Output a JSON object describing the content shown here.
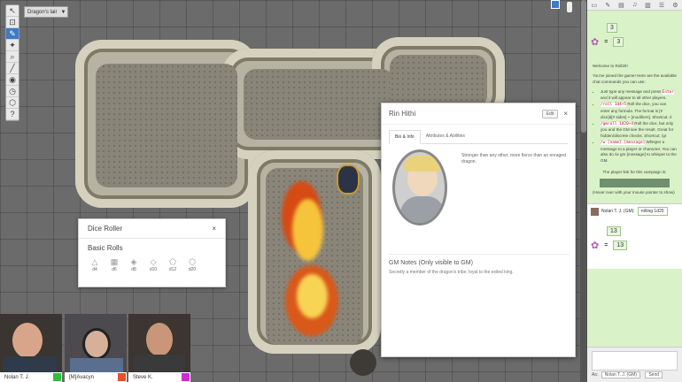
{
  "toolbar": {
    "layer_label": "Dragon's lair",
    "tools": [
      "select-icon",
      "help-icon",
      "draw-icon",
      "pointer-icon",
      "zoom-icon",
      "measure-icon",
      "fog-icon",
      "clock-icon",
      "dice-icon",
      "help-circle-icon"
    ]
  },
  "dice_roller": {
    "title": "Dice Roller",
    "close": "×",
    "section": "Basic Rolls",
    "dice": [
      "d4",
      "d6",
      "d8",
      "d10",
      "d12",
      "d20"
    ]
  },
  "character": {
    "name": "Rin Hithi",
    "edit_label": "Edit",
    "close": "×",
    "tabs": [
      "Bio & Info",
      "Attributes & Abilities"
    ],
    "bio": "Stronger than any other, more fierce than an enraged dragon.",
    "gm_notes_title": "GM Notes (Only visible to GM)",
    "gm_notes_text": "Secretly a member of the dragon's tribe, loyal to the exiled king."
  },
  "video": [
    {
      "name": "Nolan T. J.",
      "color": "#2fbf3a"
    },
    {
      "name": "[M]Avacyn",
      "color": "#e2532b"
    },
    {
      "name": "Steve K.",
      "color": "#c82fd1"
    }
  ],
  "chat": {
    "roll_top": "3",
    "roll_top_total": "3",
    "welcome_title": "Welcome to Roll20!",
    "welcome_intro": "You've joined the game! Here are the available chat commands you can use:",
    "bullets": [
      {
        "pre": "Just type any message and press ",
        "code": "Enter",
        "post": " and it will appear to all other players."
      },
      {
        "pre": "",
        "code": "/roll 1d4+5",
        "post": " Roll the dice, you can enter any formula. The format is [# dice]d[# sides] + [modifiers]. Shortcut: /r"
      },
      {
        "pre": "",
        "code": "/gmroll 1d20+4",
        "post": " Roll the dice, but only you and the GM see the result. Great for hidden/discrete checks. Shortcut: /gr"
      },
      {
        "pre": "",
        "code": "/w [name] [message]",
        "post": " Whisper a message to a player or character. You can also do /w gm [message] to whisper to the GM."
      }
    ],
    "player_link_label": "The player link for this campaign is:",
    "hover_note": "(Hover over with your mouse pointer to show)",
    "msg_author": "Nolan T. J. (GM):",
    "msg_text": "rolling 1d20",
    "roll_bottom": "13",
    "roll_bottom_total": "13",
    "as_label": "As:",
    "as_value": "Nolan T. J. (GM)",
    "send_label": "Send"
  },
  "right_tabs": [
    "chat-icon",
    "art-icon",
    "journal-icon",
    "jukebox-icon",
    "card-icon",
    "list-icon",
    "gear-icon"
  ]
}
